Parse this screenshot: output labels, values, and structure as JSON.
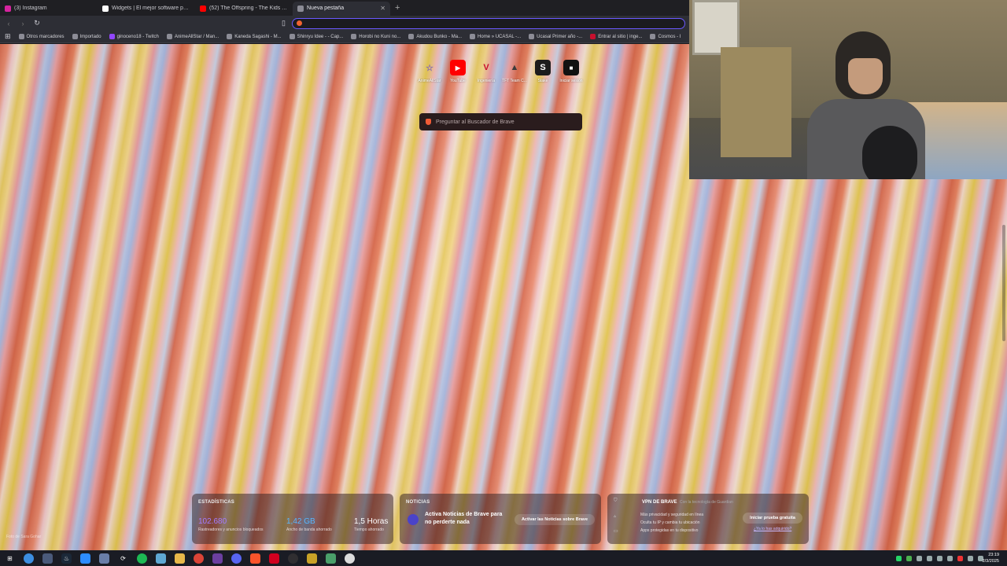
{
  "tabs": [
    {
      "title": "(3) Instagram",
      "color": "#d6249f",
      "active": false
    },
    {
      "title": "Widgets | El mejor software para pc...",
      "color": "#ffffff",
      "active": false
    },
    {
      "title": "(52) The Offspring - The Kids Ar...",
      "color": "#ff0000",
      "active": false
    },
    {
      "title": "Nueva pestaña",
      "color": "#8c8c96",
      "active": true
    }
  ],
  "toolbar": {
    "new_tab": "+",
    "omnibox_value": ""
  },
  "bookmarks": [
    "Otros marcadores",
    "Importado",
    "ginoceno18 - Twitch",
    "AnimeAllStar / Man...",
    "Kaneda Sagashi - M...",
    "Shinryu Idee - - Cap...",
    "Horobi no Kuni no...",
    "Akudou Bunko - Ma...",
    "Home » UCASAL -...",
    "Ucasal Primer año -...",
    "Entrar al sitio | inge...",
    "Cosmos - I"
  ],
  "top_sites": [
    {
      "label": "AnimeAllStar",
      "glyph": "☆",
      "color": "#8a6fb0"
    },
    {
      "label": "YouTube",
      "glyph": "▶",
      "color": "#ff0000"
    },
    {
      "label": "Ingeniería",
      "glyph": "V",
      "color": "#c8102e"
    },
    {
      "label": "TFT Team C...",
      "glyph": "▲",
      "color": "#3a3a3a"
    },
    {
      "label": "Stake",
      "glyph": "S",
      "color": "#1c1c1c"
    },
    {
      "label": "Iniciar sesión",
      "glyph": "■",
      "color": "#111111"
    }
  ],
  "search": {
    "placeholder": "Preguntar al Buscador de Brave"
  },
  "stats": {
    "title": "ESTADÍSTICAS",
    "items": [
      {
        "value": "102.680",
        "desc": "Rastreadores y anuncios bloqueados"
      },
      {
        "value": "1,42 GB",
        "desc": "Ancho de banda ahorrado"
      },
      {
        "value": "1,5 Horas",
        "desc": "Tiempo ahorrado"
      }
    ]
  },
  "news": {
    "title": "NOTICIAS",
    "text": "Activa Noticias de Brave para no perderte nada",
    "button": "Activar las Noticias sobre Brave"
  },
  "vpn": {
    "title": "VPN DE BRAVE",
    "subtitle": "Con la tecnología de Guardian",
    "lines": [
      "Más privacidad y seguridad en línea",
      "Oculta tu IP y cambia tu ubicación",
      "Apps protegidas en tu dispositivo"
    ],
    "button": "Iniciar prueba gratuita",
    "link": "¿Ya lo has adquirido?"
  },
  "photo_credit": "Foto de Sara Gohar",
  "clock": {
    "time": "23:19",
    "date": "2/3/2025"
  },
  "accent": "#6a58ff"
}
